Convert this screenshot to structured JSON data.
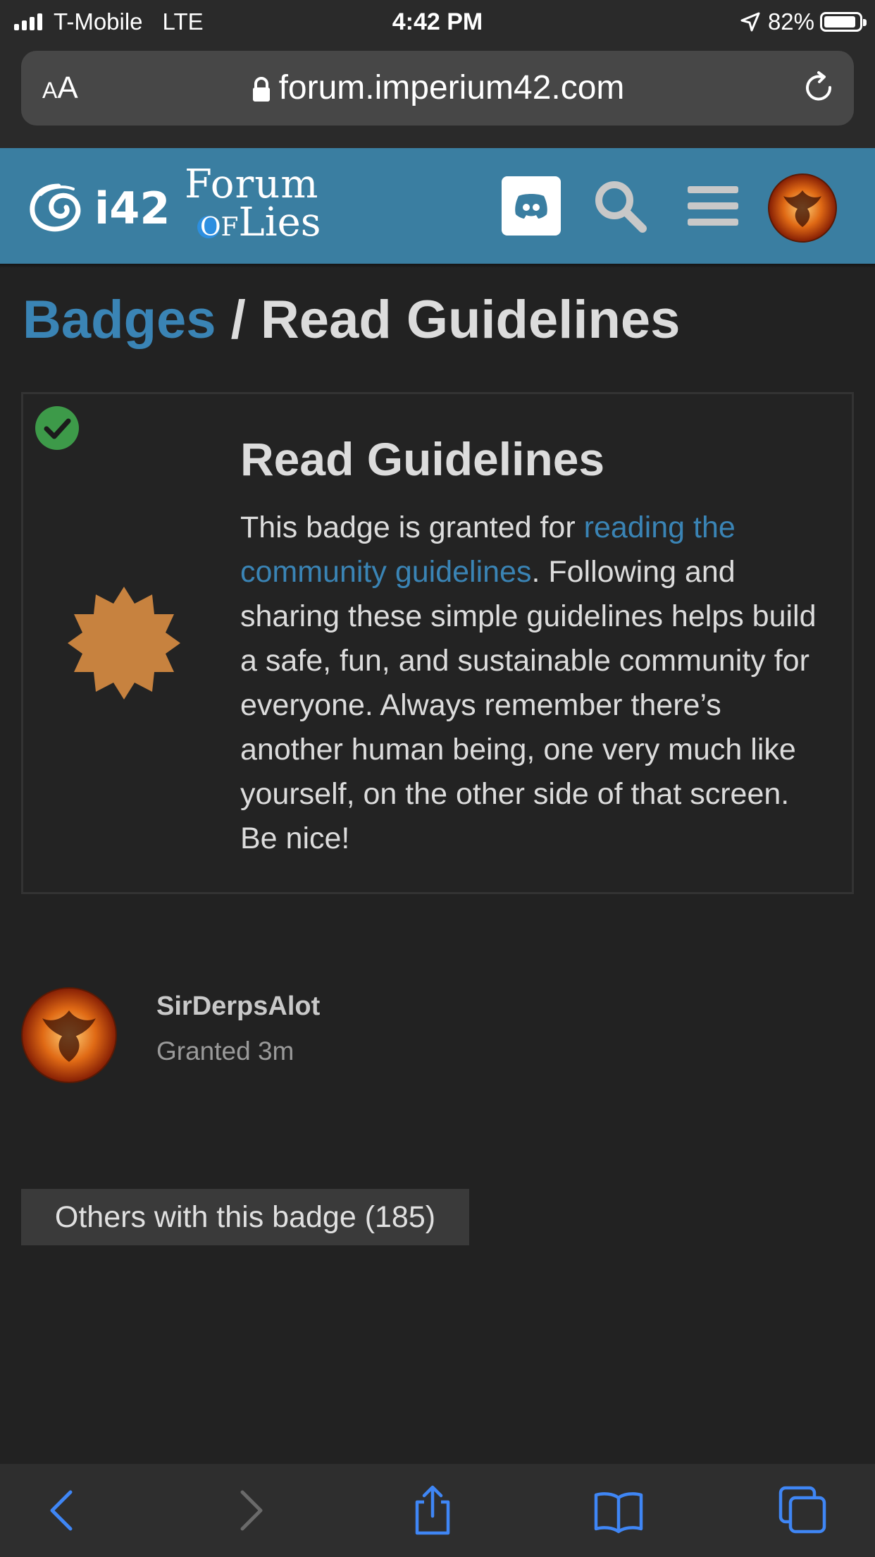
{
  "status_bar": {
    "carrier": "T-Mobile",
    "network": "LTE",
    "time": "4:42 PM",
    "battery": "82%",
    "icons": [
      "signal-icon",
      "location-arrow-icon",
      "battery-icon"
    ]
  },
  "browser": {
    "text_size_label_small": "A",
    "text_size_label_large": "A",
    "url": "forum.imperium42.com",
    "icons": [
      "lock-icon",
      "reload-icon"
    ]
  },
  "site_header": {
    "logo_i42": "i42",
    "logo_forum_line1": "Forum",
    "logo_forum_of": "OF",
    "logo_forum_line2": "Lies",
    "icons": [
      "discord-icon",
      "search-icon",
      "hamburger-menu-icon",
      "user-avatar"
    ],
    "background_color": "#3a7ea1"
  },
  "breadcrumb": {
    "parent": "Badges",
    "separator": "/",
    "current": "Read Guidelines"
  },
  "badge": {
    "title": "Read Guidelines",
    "description_before_link": "This badge is granted for ",
    "description_link": "reading the community guidelines",
    "description_after_link": ". Following and sharing these simple guidelines helps build a safe, fun, and sustainable community for everyone. Always remember there’s another human being, one very much like yourself, on the other side of that screen. Be nice!",
    "icon": "badge-star-icon",
    "badge_color": "#c7823f",
    "granted_check_color": "#3d9a49"
  },
  "grant": {
    "username": "SirDerpsAlot",
    "granted_text": "Granted 3m"
  },
  "others_button": {
    "label": "Others with this badge (185)"
  },
  "bottom_toolbar": {
    "icons": [
      "back-arrow-icon",
      "forward-arrow-icon",
      "share-icon",
      "bookmarks-icon",
      "tabs-icon"
    ],
    "accent_color": "#3f86f5"
  }
}
